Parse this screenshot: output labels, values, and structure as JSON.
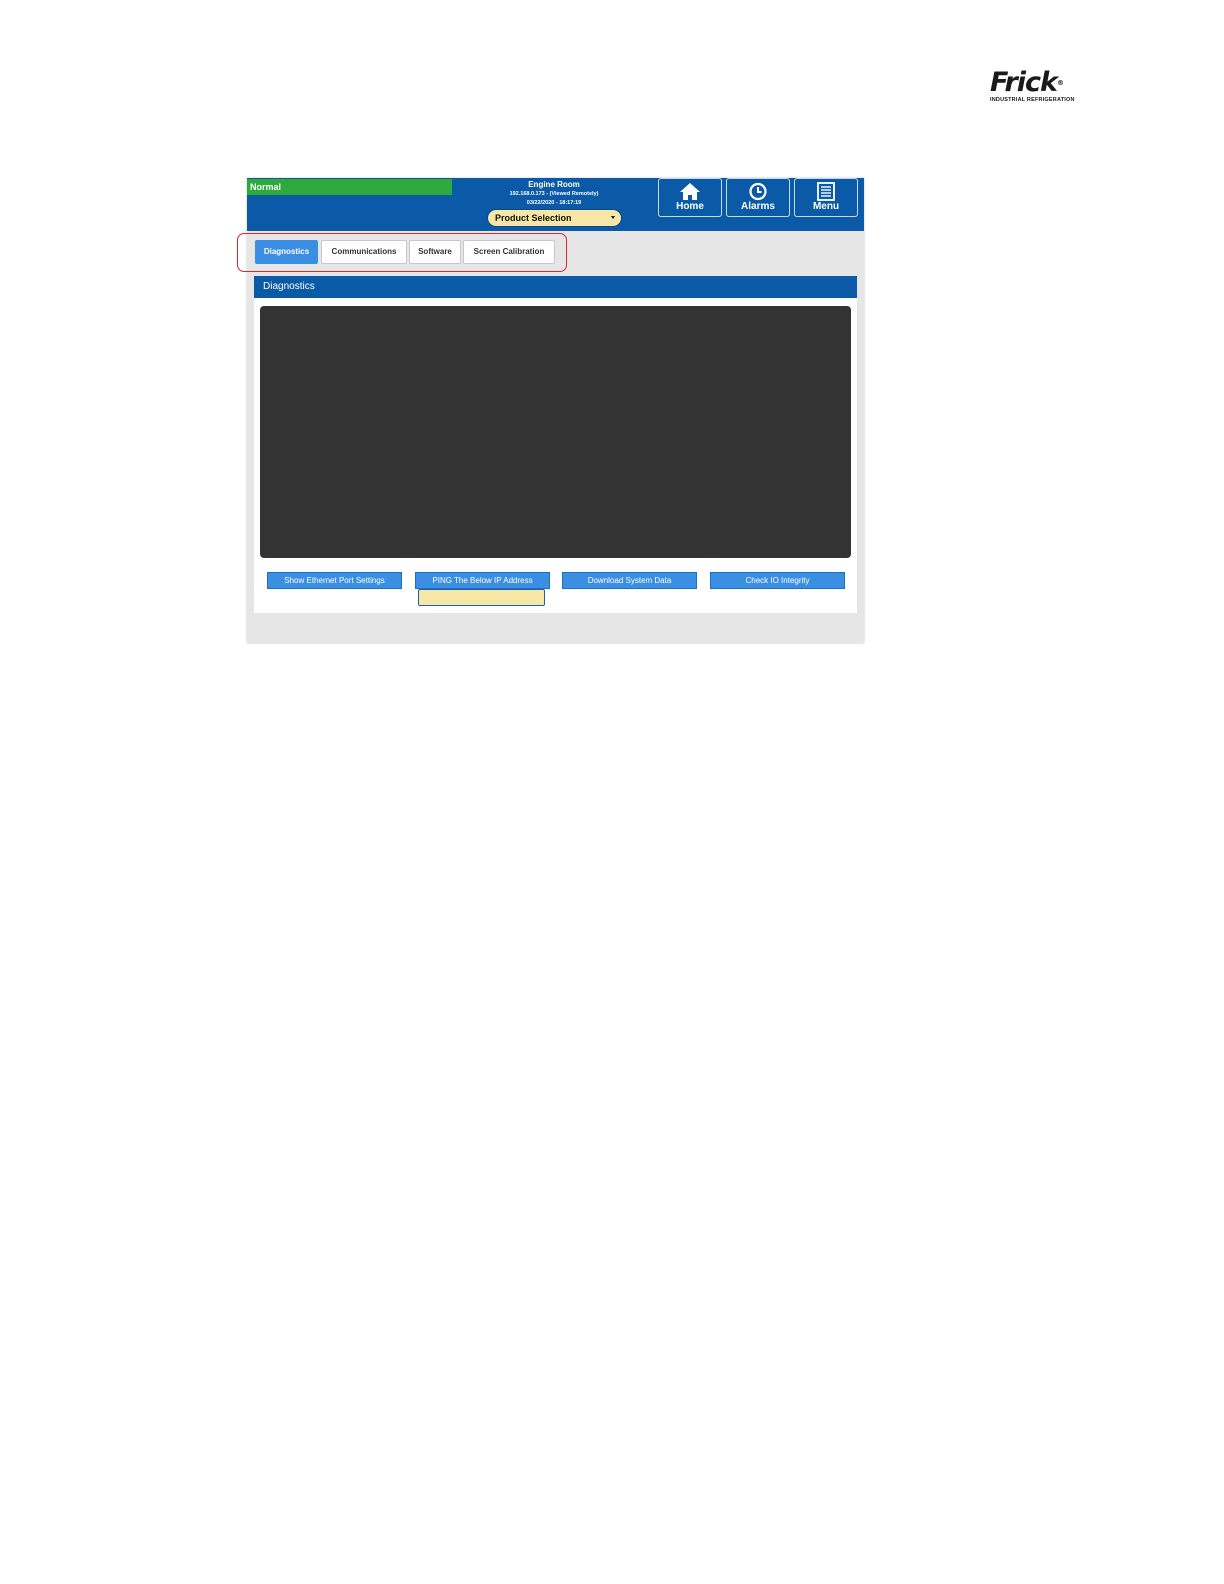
{
  "brand": {
    "name": "Frick",
    "reg_mark": "®",
    "tagline": "INDUSTRIAL  REFRIGERATION"
  },
  "header": {
    "status": "Normal",
    "site_name": "Engine Room",
    "ip_line": "192.168.0.173 - (Viewed Remotely)",
    "datetime": "03/22/2020 - 18:17:19",
    "product_selection": "Product Selection",
    "nav": {
      "home": "Home",
      "alarms": "Alarms",
      "menu": "Menu"
    }
  },
  "tabs": [
    {
      "label": "Diagnostics",
      "active": true
    },
    {
      "label": "Communications",
      "active": false
    },
    {
      "label": "Software",
      "active": false
    },
    {
      "label": "Screen Calibration",
      "active": false
    }
  ],
  "panel": {
    "title": "Diagnostics",
    "buttons": {
      "show_ethernet": "Show Ethernet Port Settings",
      "ping": "PING The Below IP Address",
      "download": "Download System Data",
      "check_io": "Check IO Integrity"
    },
    "ip_input_value": ""
  },
  "colors": {
    "header_blue": "#0b5aa8",
    "status_green": "#2eaa3c",
    "button_blue": "#3b8fe3",
    "input_yellow": "#f8e8a8",
    "console_dark": "#333333",
    "highlight_red": "#e0242a"
  }
}
